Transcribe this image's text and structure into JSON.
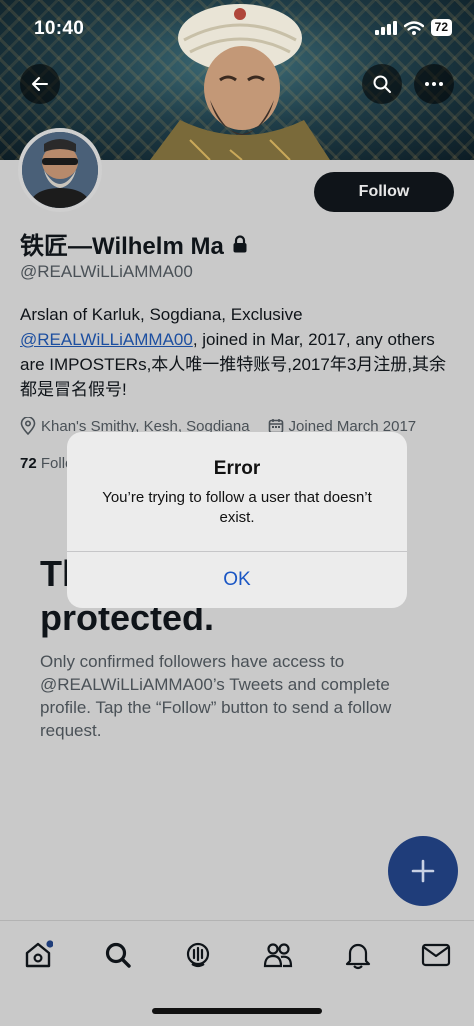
{
  "status_bar": {
    "time": "10:40",
    "battery": "72"
  },
  "profile": {
    "display_name": "铁匠—Wilhelm Ma",
    "handle": "@REALWiLLiAMMA00",
    "follow_label": "Follow",
    "bio_prefix": "Arslan of Karluk, Sogdiana, Exclusive ",
    "bio_mention": "@REALWiLLiAMMA00",
    "bio_suffix": ", joined in Mar, 2017, any others are IMPOSTERs,本人唯一推特账号,2017年3月注册,其余都是冒名假号!",
    "location": "Khan's Smithy, Kesh, Sogdiana",
    "joined": "Joined March 2017",
    "following_count": "72",
    "following_label": " Following"
  },
  "protected": {
    "title": "These Tweets are protected.",
    "description": "Only confirmed followers have access to @REALWiLLiAMMA00’s Tweets and complete profile. Tap the “Follow” button to send a follow request."
  },
  "alert": {
    "title": "Error",
    "message": "You’re trying to follow a user that doesn’t exist.",
    "ok_label": "OK"
  },
  "colors": {
    "accent": "#1a56c4",
    "fab": "#1f3d7a",
    "mention": "#1d4fa0"
  },
  "icons": [
    "back-arrow-icon",
    "search-icon",
    "more-icon",
    "lock-icon",
    "location-pin-icon",
    "calendar-icon",
    "compose-plus-icon",
    "home-icon",
    "explore-search-icon",
    "spaces-icon",
    "communities-icon",
    "notifications-bell-icon",
    "messages-envelope-icon"
  ]
}
